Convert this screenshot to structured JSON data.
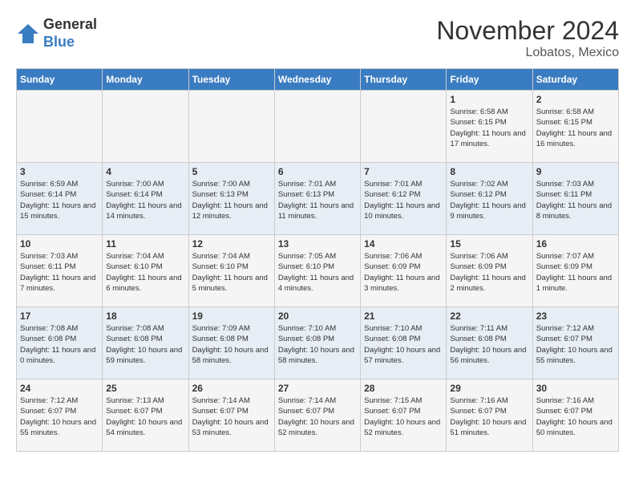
{
  "header": {
    "logo": {
      "general": "General",
      "blue": "Blue"
    },
    "title": "November 2024",
    "location": "Lobatos, Mexico"
  },
  "weekdays": [
    "Sunday",
    "Monday",
    "Tuesday",
    "Wednesday",
    "Thursday",
    "Friday",
    "Saturday"
  ],
  "weeks": [
    [
      {
        "day": "",
        "info": ""
      },
      {
        "day": "",
        "info": ""
      },
      {
        "day": "",
        "info": ""
      },
      {
        "day": "",
        "info": ""
      },
      {
        "day": "",
        "info": ""
      },
      {
        "day": "1",
        "info": "Sunrise: 6:58 AM\nSunset: 6:15 PM\nDaylight: 11 hours and 17 minutes."
      },
      {
        "day": "2",
        "info": "Sunrise: 6:58 AM\nSunset: 6:15 PM\nDaylight: 11 hours and 16 minutes."
      }
    ],
    [
      {
        "day": "3",
        "info": "Sunrise: 6:59 AM\nSunset: 6:14 PM\nDaylight: 11 hours and 15 minutes."
      },
      {
        "day": "4",
        "info": "Sunrise: 7:00 AM\nSunset: 6:14 PM\nDaylight: 11 hours and 14 minutes."
      },
      {
        "day": "5",
        "info": "Sunrise: 7:00 AM\nSunset: 6:13 PM\nDaylight: 11 hours and 12 minutes."
      },
      {
        "day": "6",
        "info": "Sunrise: 7:01 AM\nSunset: 6:13 PM\nDaylight: 11 hours and 11 minutes."
      },
      {
        "day": "7",
        "info": "Sunrise: 7:01 AM\nSunset: 6:12 PM\nDaylight: 11 hours and 10 minutes."
      },
      {
        "day": "8",
        "info": "Sunrise: 7:02 AM\nSunset: 6:12 PM\nDaylight: 11 hours and 9 minutes."
      },
      {
        "day": "9",
        "info": "Sunrise: 7:03 AM\nSunset: 6:11 PM\nDaylight: 11 hours and 8 minutes."
      }
    ],
    [
      {
        "day": "10",
        "info": "Sunrise: 7:03 AM\nSunset: 6:11 PM\nDaylight: 11 hours and 7 minutes."
      },
      {
        "day": "11",
        "info": "Sunrise: 7:04 AM\nSunset: 6:10 PM\nDaylight: 11 hours and 6 minutes."
      },
      {
        "day": "12",
        "info": "Sunrise: 7:04 AM\nSunset: 6:10 PM\nDaylight: 11 hours and 5 minutes."
      },
      {
        "day": "13",
        "info": "Sunrise: 7:05 AM\nSunset: 6:10 PM\nDaylight: 11 hours and 4 minutes."
      },
      {
        "day": "14",
        "info": "Sunrise: 7:06 AM\nSunset: 6:09 PM\nDaylight: 11 hours and 3 minutes."
      },
      {
        "day": "15",
        "info": "Sunrise: 7:06 AM\nSunset: 6:09 PM\nDaylight: 11 hours and 2 minutes."
      },
      {
        "day": "16",
        "info": "Sunrise: 7:07 AM\nSunset: 6:09 PM\nDaylight: 11 hours and 1 minute."
      }
    ],
    [
      {
        "day": "17",
        "info": "Sunrise: 7:08 AM\nSunset: 6:08 PM\nDaylight: 11 hours and 0 minutes."
      },
      {
        "day": "18",
        "info": "Sunrise: 7:08 AM\nSunset: 6:08 PM\nDaylight: 10 hours and 59 minutes."
      },
      {
        "day": "19",
        "info": "Sunrise: 7:09 AM\nSunset: 6:08 PM\nDaylight: 10 hours and 58 minutes."
      },
      {
        "day": "20",
        "info": "Sunrise: 7:10 AM\nSunset: 6:08 PM\nDaylight: 10 hours and 58 minutes."
      },
      {
        "day": "21",
        "info": "Sunrise: 7:10 AM\nSunset: 6:08 PM\nDaylight: 10 hours and 57 minutes."
      },
      {
        "day": "22",
        "info": "Sunrise: 7:11 AM\nSunset: 6:08 PM\nDaylight: 10 hours and 56 minutes."
      },
      {
        "day": "23",
        "info": "Sunrise: 7:12 AM\nSunset: 6:07 PM\nDaylight: 10 hours and 55 minutes."
      }
    ],
    [
      {
        "day": "24",
        "info": "Sunrise: 7:12 AM\nSunset: 6:07 PM\nDaylight: 10 hours and 55 minutes."
      },
      {
        "day": "25",
        "info": "Sunrise: 7:13 AM\nSunset: 6:07 PM\nDaylight: 10 hours and 54 minutes."
      },
      {
        "day": "26",
        "info": "Sunrise: 7:14 AM\nSunset: 6:07 PM\nDaylight: 10 hours and 53 minutes."
      },
      {
        "day": "27",
        "info": "Sunrise: 7:14 AM\nSunset: 6:07 PM\nDaylight: 10 hours and 52 minutes."
      },
      {
        "day": "28",
        "info": "Sunrise: 7:15 AM\nSunset: 6:07 PM\nDaylight: 10 hours and 52 minutes."
      },
      {
        "day": "29",
        "info": "Sunrise: 7:16 AM\nSunset: 6:07 PM\nDaylight: 10 hours and 51 minutes."
      },
      {
        "day": "30",
        "info": "Sunrise: 7:16 AM\nSunset: 6:07 PM\nDaylight: 10 hours and 50 minutes."
      }
    ]
  ]
}
